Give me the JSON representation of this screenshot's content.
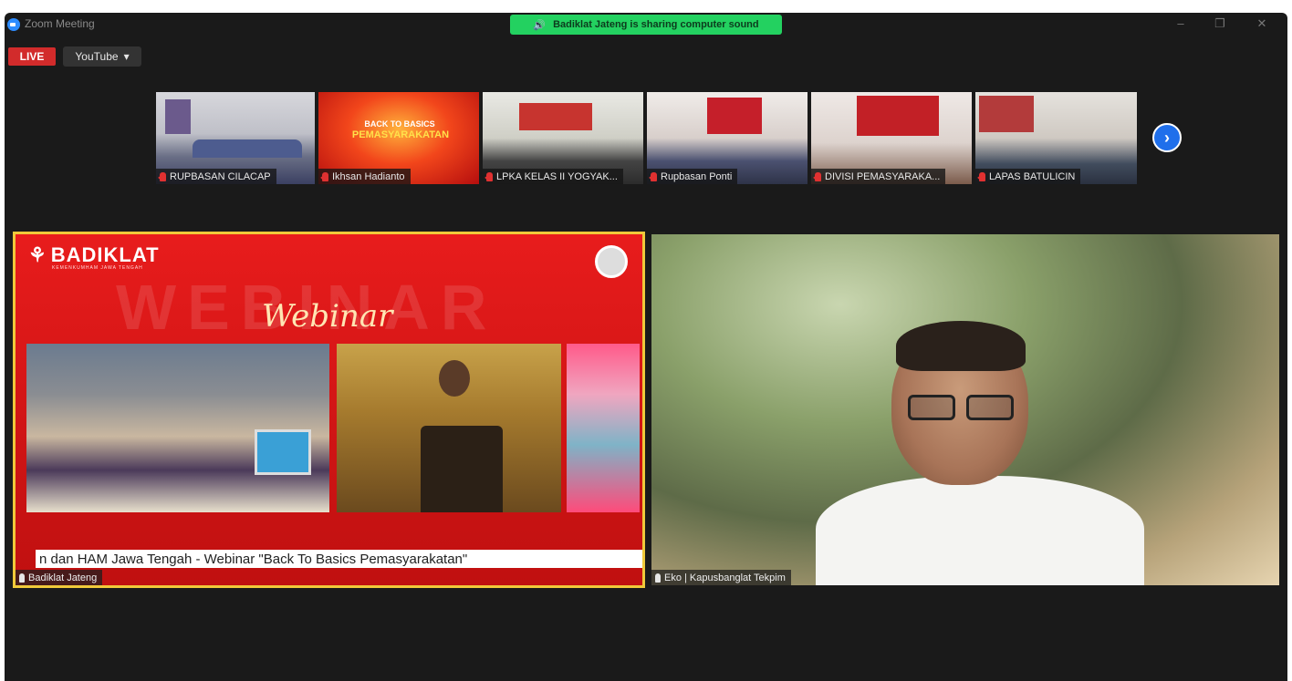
{
  "window": {
    "title": "Zoom Meeting"
  },
  "share_banner": {
    "text": "Badiklat Jateng is sharing computer sound"
  },
  "window_controls": {
    "minimize": "–",
    "restore": "❐",
    "close": "✕"
  },
  "live": {
    "badge": "LIVE",
    "platform": "YouTube",
    "platform_caret": "▾"
  },
  "thumbnails": [
    {
      "name": "RUPBASAN CILACAP"
    },
    {
      "name": "Ikhsan Hadianto"
    },
    {
      "name": "LPKA KELAS II YOGYAK..."
    },
    {
      "name": "Rupbasan Ponti"
    },
    {
      "name": "DIVISI PEMASYARAKA..."
    },
    {
      "name": "LAPAS BATULICIN"
    }
  ],
  "thumb_back_to_basics": {
    "line1": "BACK TO BASICS",
    "line2": "PEMASYARAKATAN"
  },
  "next_page_symbol": "›",
  "main_videos": {
    "left": {
      "name": "Badiklat Jateng",
      "logo": "BADIKLAT",
      "logo_sub": "KEMENKUMHAM JAWA TENGAH",
      "watermark": "WEBINAR",
      "script_title": "Webinar",
      "ticker": "n dan HAM Jawa Tengah - Webinar \"Back To Basics Pemasyarakatan\""
    },
    "right": {
      "name": "Eko | Kapusbanglat Tekpim"
    }
  },
  "colors": {
    "banner_green": "#23d160",
    "live_red": "#d22b2b",
    "active_border": "#f0c93a",
    "next_blue": "#1f6feb"
  }
}
